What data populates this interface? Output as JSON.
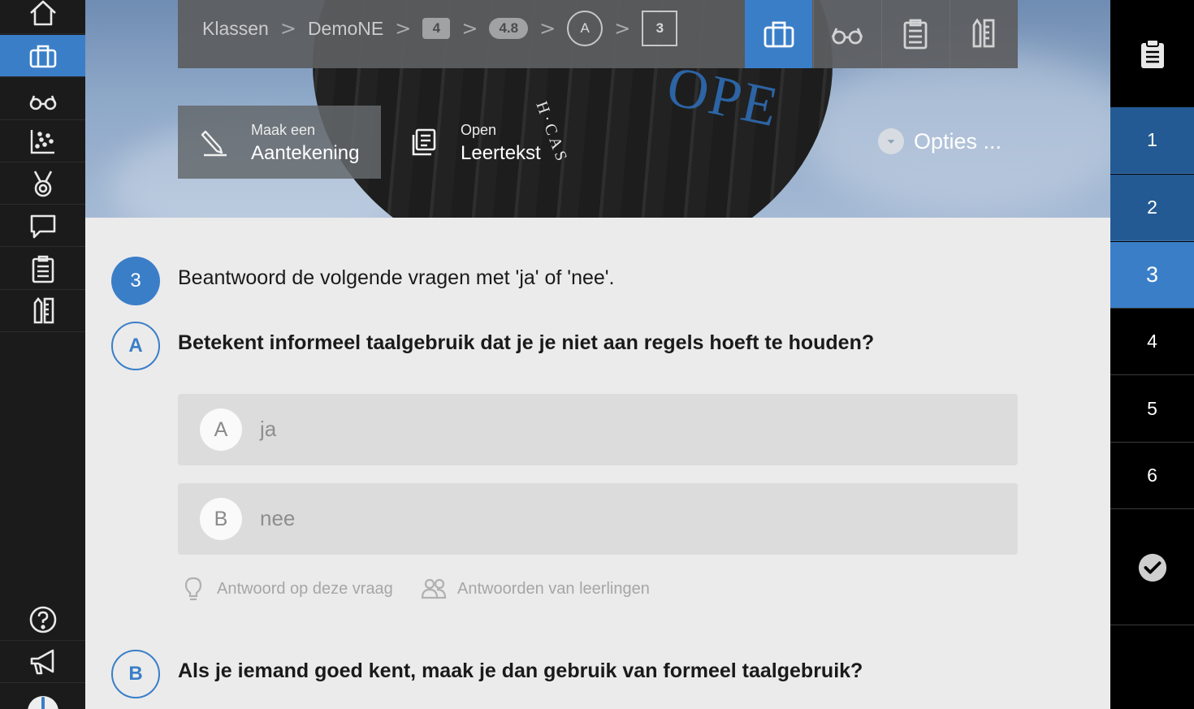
{
  "breadcrumb": {
    "items": [
      {
        "type": "text",
        "label": "Klassen"
      },
      {
        "type": "text",
        "label": "DemoNE"
      },
      {
        "type": "box",
        "label": "4"
      },
      {
        "type": "pill",
        "label": "4.8"
      },
      {
        "type": "circle",
        "label": "A"
      },
      {
        "type": "square",
        "label": "3"
      }
    ],
    "separator": ">"
  },
  "toolbar": {
    "buttons": [
      {
        "name": "briefcase-icon",
        "active": true
      },
      {
        "name": "glasses-icon",
        "active": false
      },
      {
        "name": "clipboard-icon",
        "active": false
      },
      {
        "name": "ruler-pencil-icon",
        "active": false
      }
    ]
  },
  "actions": {
    "note_small": "Maak een",
    "note_big": "Aantekening",
    "read_small": "Open",
    "read_big": "Leertekst",
    "options_label": "Opties ..."
  },
  "hero": {
    "balloon_text": "OPE",
    "balloon_letters": "H·CAS"
  },
  "exercise": {
    "number": "3",
    "instruction": "Beantwoord de volgende vragen met 'ja' of 'nee'.",
    "questions": [
      {
        "letter": "A",
        "text": "Betekent informeel taalgebruik dat je je niet aan regels hoeft te houden?",
        "options": [
          {
            "letter": "A",
            "label": "ja"
          },
          {
            "letter": "B",
            "label": "nee"
          }
        ],
        "helpers": {
          "answer_label": "Antwoord op deze vraag",
          "students_label": "Antwoorden van leerlingen"
        }
      },
      {
        "letter": "B",
        "text": "Als je iemand goed kent, maak je dan gebruik van formeel taalgebruik?"
      }
    ]
  },
  "right_panel": {
    "items": [
      {
        "label": "1",
        "state": "done"
      },
      {
        "label": "2",
        "state": "done"
      },
      {
        "label": "3",
        "state": "current"
      },
      {
        "label": "4",
        "state": "open"
      },
      {
        "label": "5",
        "state": "open"
      },
      {
        "label": "6",
        "state": "open"
      }
    ]
  },
  "left_sidebar": {
    "items": [
      {
        "name": "home-icon"
      },
      {
        "name": "briefcase-icon",
        "active": true
      },
      {
        "name": "glasses-icon"
      },
      {
        "name": "scatter-chart-icon"
      },
      {
        "name": "medal-icon"
      },
      {
        "name": "chat-bubble-icon"
      },
      {
        "name": "clipboard-icon"
      },
      {
        "name": "ruler-pencil-icon"
      },
      {
        "name": "help-icon"
      },
      {
        "name": "megaphone-icon"
      },
      {
        "name": "user-avatar-icon"
      }
    ]
  },
  "colors": {
    "accent": "#3a7ec8",
    "accent_dark": "#245a93",
    "sidebar": "#1b1b1b"
  }
}
